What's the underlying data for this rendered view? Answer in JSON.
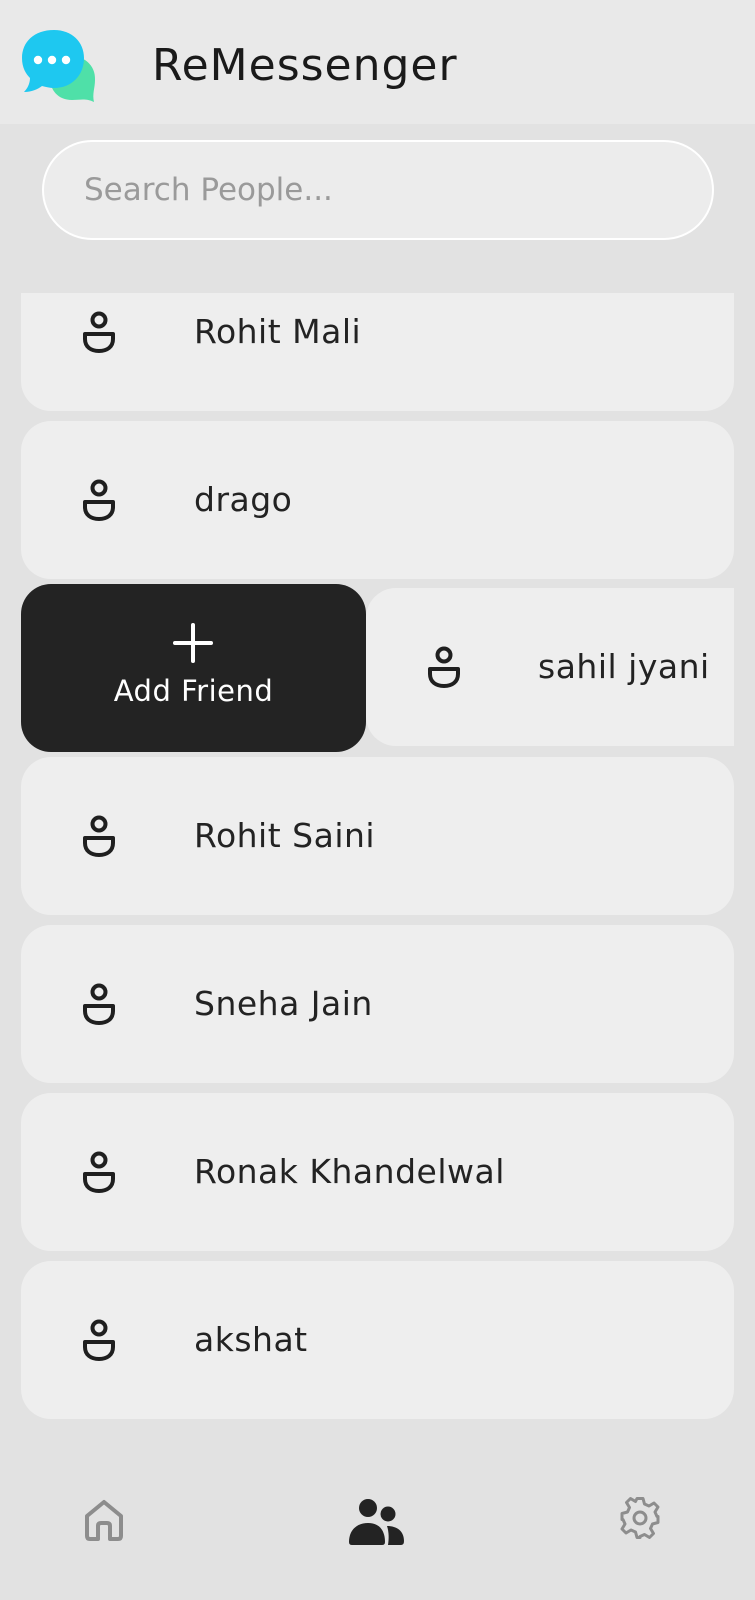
{
  "header": {
    "title": "ReMessenger",
    "logo_icon": "chat-bubbles-logo"
  },
  "search": {
    "placeholder": "Search People...",
    "value": ""
  },
  "people": [
    {
      "name": "Rohit Mali",
      "icon": "person-icon"
    },
    {
      "name": "drago",
      "icon": "person-icon"
    },
    {
      "name": "sahil jyani",
      "icon": "person-icon",
      "swipe_action": "Add Friend"
    },
    {
      "name": "Rohit Saini",
      "icon": "person-icon"
    },
    {
      "name": "Sneha Jain",
      "icon": "person-icon"
    },
    {
      "name": "Ronak Khandelwal",
      "icon": "person-icon"
    },
    {
      "name": "akshat",
      "icon": "person-icon"
    }
  ],
  "add_friend": {
    "label": "Add Friend",
    "icon": "plus-icon"
  },
  "bottom_nav": {
    "items": [
      {
        "name": "home",
        "icon": "home-icon",
        "active": false
      },
      {
        "name": "people",
        "icon": "people-icon",
        "active": true
      },
      {
        "name": "settings",
        "icon": "gear-icon",
        "active": false
      }
    ]
  },
  "colors": {
    "background": "#e2e2e2",
    "card": "#eeeeee",
    "action_dark": "#232323",
    "logo_blue": "#1ec8f0",
    "logo_green": "#4fe0a8"
  }
}
